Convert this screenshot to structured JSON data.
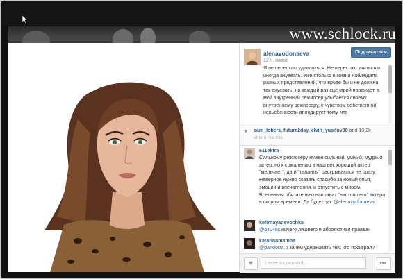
{
  "watermark": "www.schlock.ru",
  "post": {
    "username": "alenavodonaeva",
    "follow_label": "Подписаться",
    "time_ago": "12 ч. назад",
    "caption": "Я не перестаю удивляться. Не перестаю учиться и иногда ахуевать. Уже столько в жизни наблюдала разных представлений, что вроде бы и не должна так ахуевать, но каждый раз сценарий поражает, а мой внутренний режиссер улыбается своему внутреннему режиссеру, с чувством собственной невьебенности аплодирует тому, что"
  },
  "likes": {
    "liker1": "sam_lokers",
    "liker2": "future2day",
    "liker3": "elvin_yusifov88",
    "and_more": "and 13.2k",
    "others_text": "others like this."
  },
  "comments": [
    {
      "user": "e11ektra",
      "text": "Сильному режиссеру нужен сильный, умный, мудрый актер, но к сожалению в наш век хороший актер \"мельчает\", да и \"таланты\" раскрываются не сразу. Наверное нужно сказать спасибо за новый опыт, эмоции и впечатления, и отпустить с миром. Вселенная обязательно направит \"настоящего\" актера в скором времени. Да будет так",
      "mention": "@alenavodonaeva"
    },
    {
      "user": "kefirnayadevochka",
      "mention": "@o404kc",
      "text": "ничего лишнего и абсолютная правда!"
    },
    {
      "user": "katarinamamba",
      "mention": "@pandorra.o",
      "text": "зачем удерживать тех, кто проиграл?"
    }
  ],
  "input": {
    "placeholder": "Leave a comment..."
  },
  "icons": {
    "like": "heart-icon",
    "more": "more-dots-icon",
    "cursor": "mouse-cursor-icon"
  },
  "colors": {
    "link": "#2d5d8b",
    "follow_button": "#4a7aa6"
  }
}
